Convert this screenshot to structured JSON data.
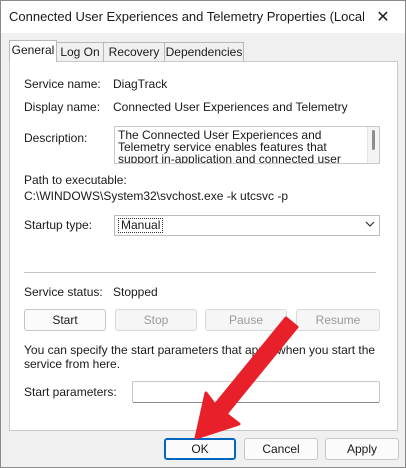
{
  "window": {
    "title": "Connected User Experiences and Telemetry Properties (Local Comp...",
    "close_glyph": "✕"
  },
  "tabs": [
    {
      "label": "General"
    },
    {
      "label": "Log On"
    },
    {
      "label": "Recovery"
    },
    {
      "label": "Dependencies"
    }
  ],
  "general": {
    "service_name_label": "Service name:",
    "service_name": "DiagTrack",
    "display_name_label": "Display name:",
    "display_name": "Connected User Experiences and Telemetry",
    "description_label": "Description:",
    "description": "The Connected User Experiences and Telemetry service enables features that support in-application and connected user experiences. Additionally, this",
    "path_label": "Path to executable:",
    "path": "C:\\WINDOWS\\System32\\svchost.exe -k utcsvc -p",
    "startup_type_label": "Startup type:",
    "startup_type": "Manual",
    "service_status_label": "Service status:",
    "service_status": "Stopped",
    "buttons": {
      "start": "Start",
      "stop": "Stop",
      "pause": "Pause",
      "resume": "Resume"
    },
    "hint": "You can specify the start parameters that apply when you start the service from here.",
    "start_params_label": "Start parameters:",
    "start_params_value": ""
  },
  "footer": {
    "ok": "OK",
    "cancel": "Cancel",
    "apply": "Apply"
  },
  "colors": {
    "annotation_arrow": "#e8202a",
    "focus_border": "#0067c0"
  }
}
